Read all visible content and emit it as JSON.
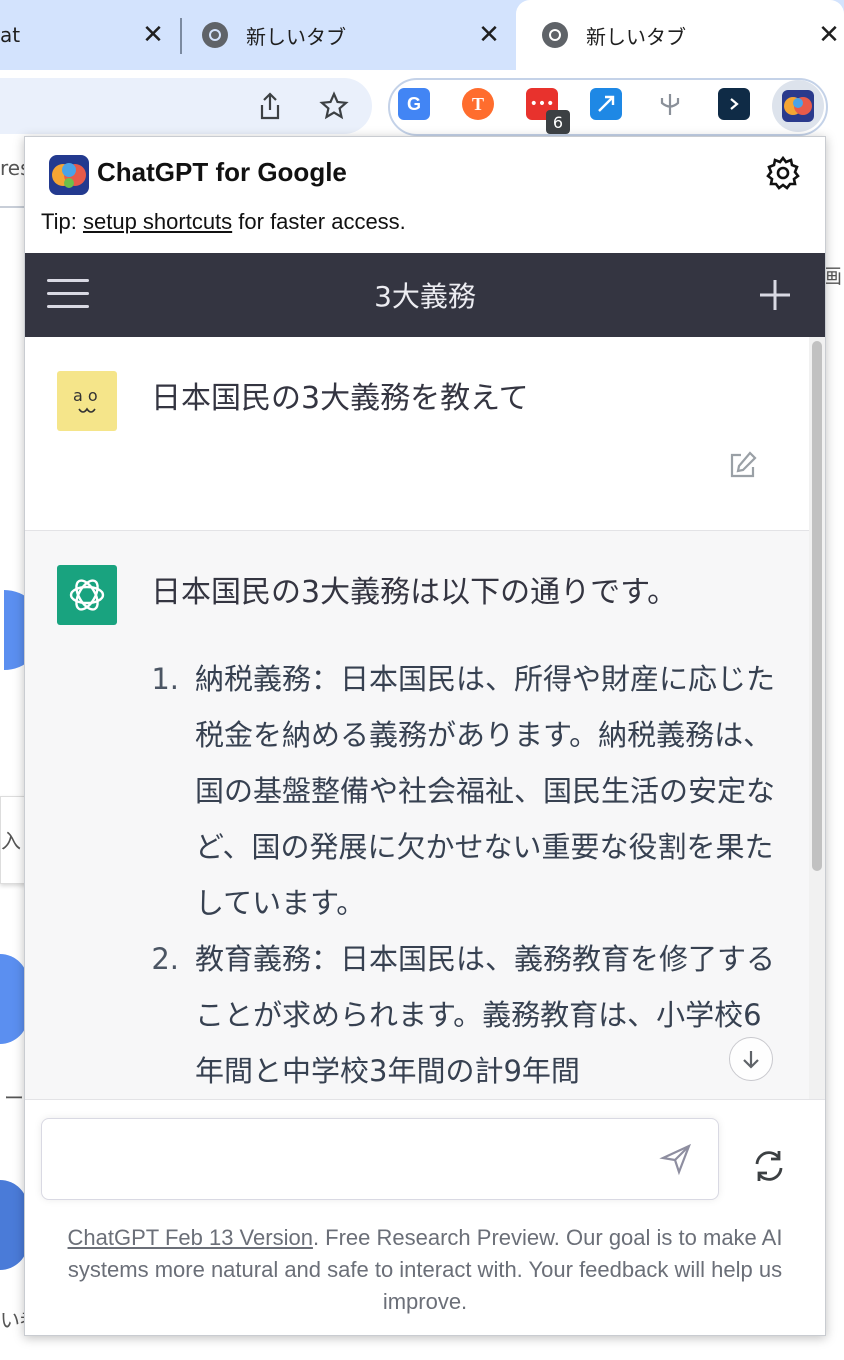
{
  "browser": {
    "tabs": [
      {
        "title": "at"
      },
      {
        "title": "新しいタブ"
      },
      {
        "title": "新しいタブ"
      }
    ],
    "extensions": {
      "badge_count": "6"
    }
  },
  "background_page": {
    "snippet_top": "res",
    "snippet_right": "画",
    "snippet_input": "入",
    "snippet_dash": "ー",
    "snippet_bottom": "い者"
  },
  "popup": {
    "title": "ChatGPT for Google",
    "tip": {
      "prefix": "Tip: ",
      "link": "setup shortcuts",
      "suffix": " for faster access."
    }
  },
  "chat": {
    "nav_title": "3大義務",
    "user_message": "日本国民の3大義務を教えて",
    "user_avatar_text": "a o",
    "bot_intro": "日本国民の3大義務は以下の通りです。",
    "bot_list": [
      {
        "num": "1.",
        "text": "納税義務：日本国民は、所得や財産に応じた税金を納める義務があります。納税義務は、国の基盤整備や社会福祉、国民生活の安定など、国の発展に欠かせない重要な役割を果たしています。"
      },
      {
        "num": "2.",
        "text": "教育義務：日本国民は、義務教育を修了することが求められます。義務教育は、小学校6年間と中学校3年間の計9年間"
      }
    ]
  },
  "composer": {
    "placeholder": "",
    "disclaimer_link": "ChatGPT Feb 13 Version",
    "disclaimer_text": ". Free Research Preview. Our goal is to make AI systems more natural and safe to interact with. Your feedback will help us improve."
  },
  "colors": {
    "nav_bg": "#343541",
    "bot_avatar": "#19a37f",
    "user_avatar": "#f5e58a",
    "tab_strip": "#d3e3fd"
  },
  "icons": [
    "chrome-icon",
    "close-icon",
    "share-icon",
    "star-icon",
    "translate-icon",
    "settings-icon",
    "menu-icon",
    "plus-icon",
    "edit-icon",
    "openai-icon",
    "arrow-down-icon",
    "send-icon",
    "refresh-icon"
  ]
}
